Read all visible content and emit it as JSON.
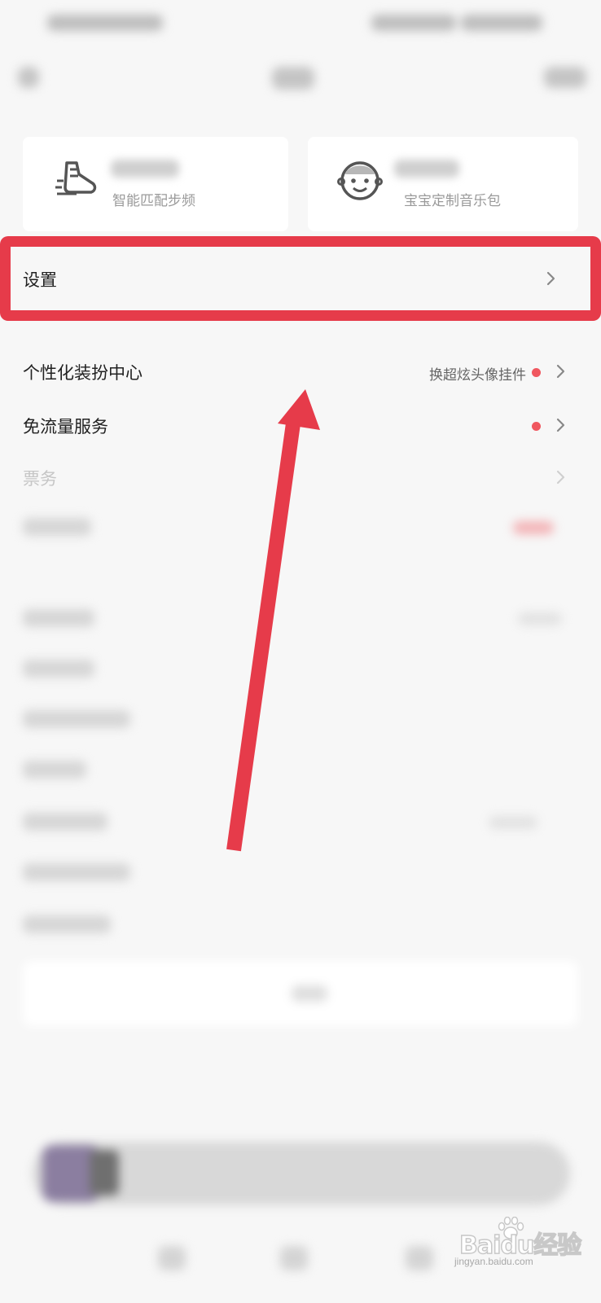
{
  "cards": [
    {
      "icon": "sneaker-icon",
      "subtitle": "智能匹配步频"
    },
    {
      "icon": "baby-face-icon",
      "subtitle": "宝宝定制音乐包"
    }
  ],
  "settings_row": {
    "label": "设置",
    "icon": "chevron-right-icon"
  },
  "menu": [
    {
      "label": "个性化装扮中心",
      "right_text": "换超炫头像挂件",
      "has_dot": true
    },
    {
      "label": "免流量服务",
      "right_text": "",
      "has_dot": true
    },
    {
      "label": "票务",
      "right_text": "",
      "has_dot": false
    }
  ],
  "annotation": {
    "highlight_color": "#e63b4a",
    "arrow_color": "#e63b4a"
  },
  "watermark": {
    "brand": "Baidu经验",
    "site": "jingyan.baidu.com"
  },
  "colors": {
    "dot": "#f0575f",
    "background": "#f7f7f7",
    "text": "#222222",
    "muted": "#9a9a9a"
  }
}
